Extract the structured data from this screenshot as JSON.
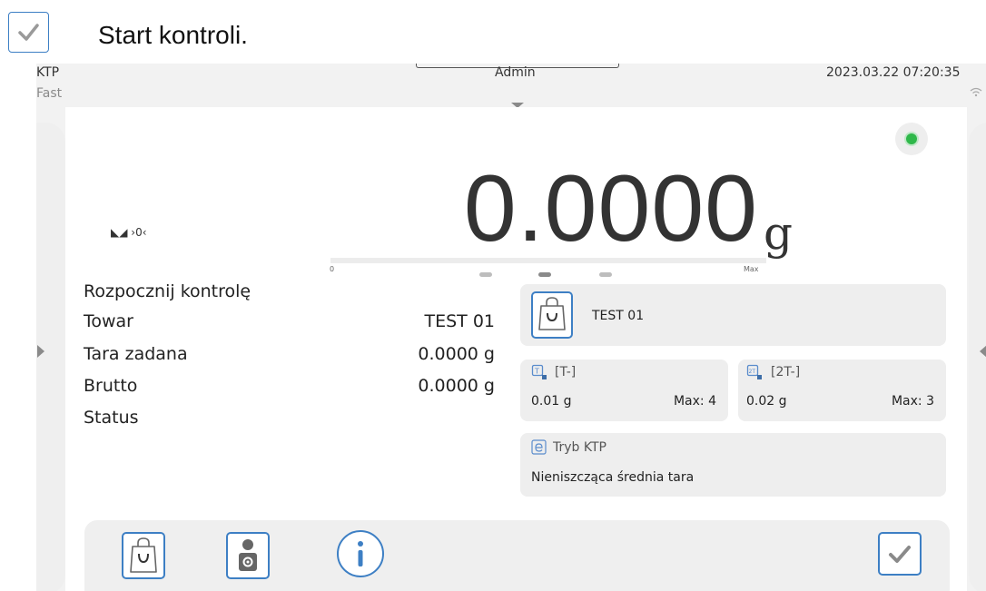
{
  "caption": {
    "text": "Start kontroli."
  },
  "status_bar": {
    "mode": "KTP",
    "profile": "Fast",
    "user": "Admin",
    "datetime": "2023.03.22 07:20:35"
  },
  "reading": {
    "value": "0.0000",
    "unit": "g",
    "indicators": "◣◢ ›0‹",
    "bar_min": "0",
    "bar_max": "Max",
    "bar_fill": 0
  },
  "info": {
    "heading": "Rozpocznij kontrolę",
    "rows": [
      {
        "label": "Towar",
        "value": "TEST 01"
      },
      {
        "label": "Tara zadana",
        "value": "0.0000 g"
      },
      {
        "label": "Brutto",
        "value": "0.0000 g"
      },
      {
        "label": "Status",
        "value": ""
      }
    ]
  },
  "cards": {
    "product": {
      "label": "TEST 01"
    },
    "t_minus": {
      "title": "[T-]",
      "value": "0.01 g",
      "max": "Max: 4"
    },
    "t2_minus": {
      "title": "[2T-]",
      "value": "0.02 g",
      "max": "Max: 3"
    },
    "mode": {
      "title": "Tryb KTP",
      "value": "Nieniszcząca średnia tara"
    }
  },
  "colors": {
    "accent": "#3d7fc4",
    "status_led": "#2fb84a"
  }
}
